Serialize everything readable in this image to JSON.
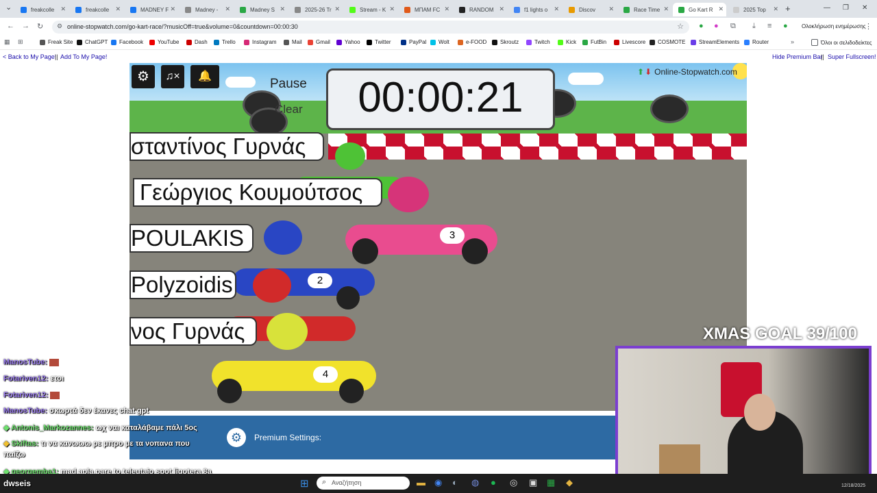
{
  "browser": {
    "tabs": [
      {
        "title": "freakcolle",
        "color": "#1877f2"
      },
      {
        "title": "freakcolle",
        "color": "#1877f2"
      },
      {
        "title": "MADNEY F",
        "color": "#1877f2"
      },
      {
        "title": "Madney -",
        "color": "#888888"
      },
      {
        "title": "Madney S",
        "color": "#2aa845"
      },
      {
        "title": "2025-26 Tr",
        "color": "#888888"
      },
      {
        "title": "Stream - K",
        "color": "#53fc18"
      },
      {
        "title": "ΜΠΑΜ FC",
        "color": "#e05a1a"
      },
      {
        "title": "RANDOM",
        "color": "#222222"
      },
      {
        "title": "f1 lights o",
        "color": "#4285f4"
      },
      {
        "title": "Discov",
        "color": "#e89a00"
      },
      {
        "title": "Race Time",
        "color": "#2aa845"
      },
      {
        "title": "Go Kart R",
        "color": "#2aa845"
      },
      {
        "title": "2025 Top",
        "color": "#cccccc"
      }
    ],
    "url": "online-stopwatch.com/go-kart-race/?musicOff=true&volume=0&countdown=00:00:30",
    "update_label": "Ολοκλήρωση ενημέρωσης",
    "bookmarks": [
      "Freak Site",
      "ChatGPT",
      "Facebook",
      "YouTube",
      "Dash",
      "Trello",
      "Instagram",
      "Mail",
      "Gmail",
      "Yahoo",
      "Twitter",
      "PayPal",
      "Wolt",
      "e-FOOD",
      "Skroutz",
      "Twitch",
      "Kick",
      "FutBin",
      "Livescore",
      "COSMOTE",
      "StreamElements",
      "Router"
    ],
    "all_bookmarks": "Όλοι οι σελιδοδείκτες"
  },
  "page": {
    "back_link": "< Back to My Page!",
    "add_link": "Add To My Page!",
    "separator": "||",
    "hide_link": "Hide Premium Bar",
    "fullscreen_link": "Super Fullscreen!"
  },
  "game": {
    "logo": "Online-Stopwatch.com",
    "pause": "Pause",
    "clear": "Clear",
    "timer": "00:00:21",
    "racers": [
      {
        "name": "σταντίνος Γυρνάς",
        "number": "",
        "color": "#4ec236"
      },
      {
        "name": "Γεώργιος Κουμούτσος",
        "number": "3",
        "color": "#e94c8f"
      },
      {
        "name": "POULAKIS",
        "number": "2",
        "color": "#2946c4"
      },
      {
        "name": "Polyzoidis",
        "number": "",
        "color": "#d12a2a"
      },
      {
        "name": "νος Γυρνάς",
        "number": "4",
        "color": "#f1e22b"
      }
    ]
  },
  "premium": {
    "label": "Premium Settings:"
  },
  "chat": [
    {
      "user": "ManosTube:",
      "text": ""
    },
    {
      "user": "Fotariven12:",
      "text": "ετοι"
    },
    {
      "user": "Fotariven12:",
      "text": ""
    },
    {
      "user": "ManosTube:",
      "text": "σκωρτά δεν έκανες chat gpt"
    },
    {
      "user": "Antonis_Markozannes:",
      "text": "ωχ ναι καταλάβαμε πάλι 5ος"
    },
    {
      "user": "Skiftas:",
      "text": "τι να κανωωω ρε μπρο με τα νοπανα που"
    },
    {
      "user": "",
      "text": "παίζω"
    },
    {
      "user": "georgemba1:",
      "text": "mad apla pare to teleutaio spot ligotera 8a"
    },
    {
      "user": "",
      "text": "dwseis"
    }
  ],
  "overlay": {
    "goal": "XMAS GOAL 39/100"
  },
  "taskbar": {
    "search_placeholder": "Αναζήτηση",
    "date": "12/18/2025"
  }
}
